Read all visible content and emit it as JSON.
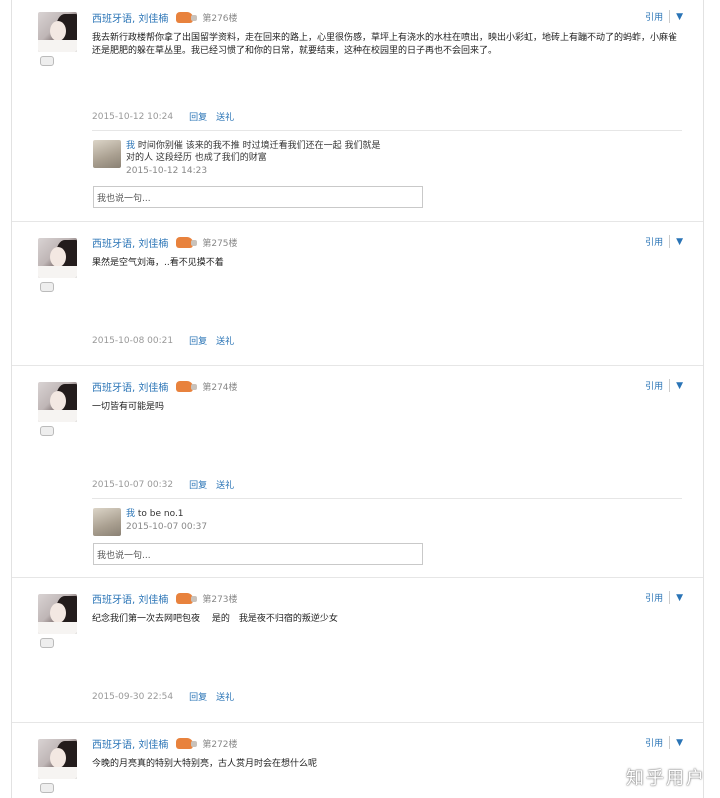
{
  "posts": [
    {
      "author": "西班牙语, 刘佳楠",
      "floor": "第276楼",
      "quote": "引用",
      "text": "我去新行政楼帮你拿了出国留学资料，走在回来的路上，心里很伤感，草坪上有浇水的水柱在喷出，映出小彩虹，地砖上有蹦不动了的蚂蚱，小麻雀还是肥肥的躲在草丛里。我已经习惯了和你的日常，就要结束，这种在校园里的日子再也不会回来了。",
      "time": "2015-10-12 10:24",
      "reply": "回复",
      "gift": "送礼",
      "replies": [
        {
          "name": "我",
          "text": "时间你别催 该来的我不推 时过境迁看我们还在一起 我们就是对的人 这段经历 也成了我们的财富",
          "time": "2015-10-12 14:23"
        }
      ],
      "input_placeholder": "我也说一句..."
    },
    {
      "author": "西班牙语, 刘佳楠",
      "floor": "第275楼",
      "quote": "引用",
      "text": "果然是空气刘海，..看不见摸不着",
      "time": "2015-10-08 00:21",
      "reply": "回复",
      "gift": "送礼"
    },
    {
      "author": "西班牙语, 刘佳楠",
      "floor": "第274楼",
      "quote": "引用",
      "text": "一切皆有可能是吗",
      "time": "2015-10-07 00:32",
      "reply": "回复",
      "gift": "送礼",
      "replies": [
        {
          "name": "我",
          "text": "to be no.1",
          "time": "2015-10-07 00:37"
        }
      ],
      "input_placeholder": "我也说一句..."
    },
    {
      "author": "西班牙语, 刘佳楠",
      "floor": "第273楼",
      "quote": "引用",
      "text": "纪念我们第一次去网吧包夜　 是的　我是夜不归宿的叛逆少女",
      "time": "2015-09-30 22:54",
      "reply": "回复",
      "gift": "送礼"
    },
    {
      "author": "西班牙语, 刘佳楠",
      "floor": "第272楼",
      "quote": "引用",
      "text": "今晚的月亮真的特别大特别亮，古人赏月时会在想什么呢"
    }
  ],
  "watermark": "知乎用户",
  "icons": {
    "caret": "caret-down-icon",
    "rank": "rank-badge-icon",
    "level": "user-level-icon"
  },
  "colors": {
    "link": "#2a74b6",
    "rank_badge": "#e8823d"
  }
}
